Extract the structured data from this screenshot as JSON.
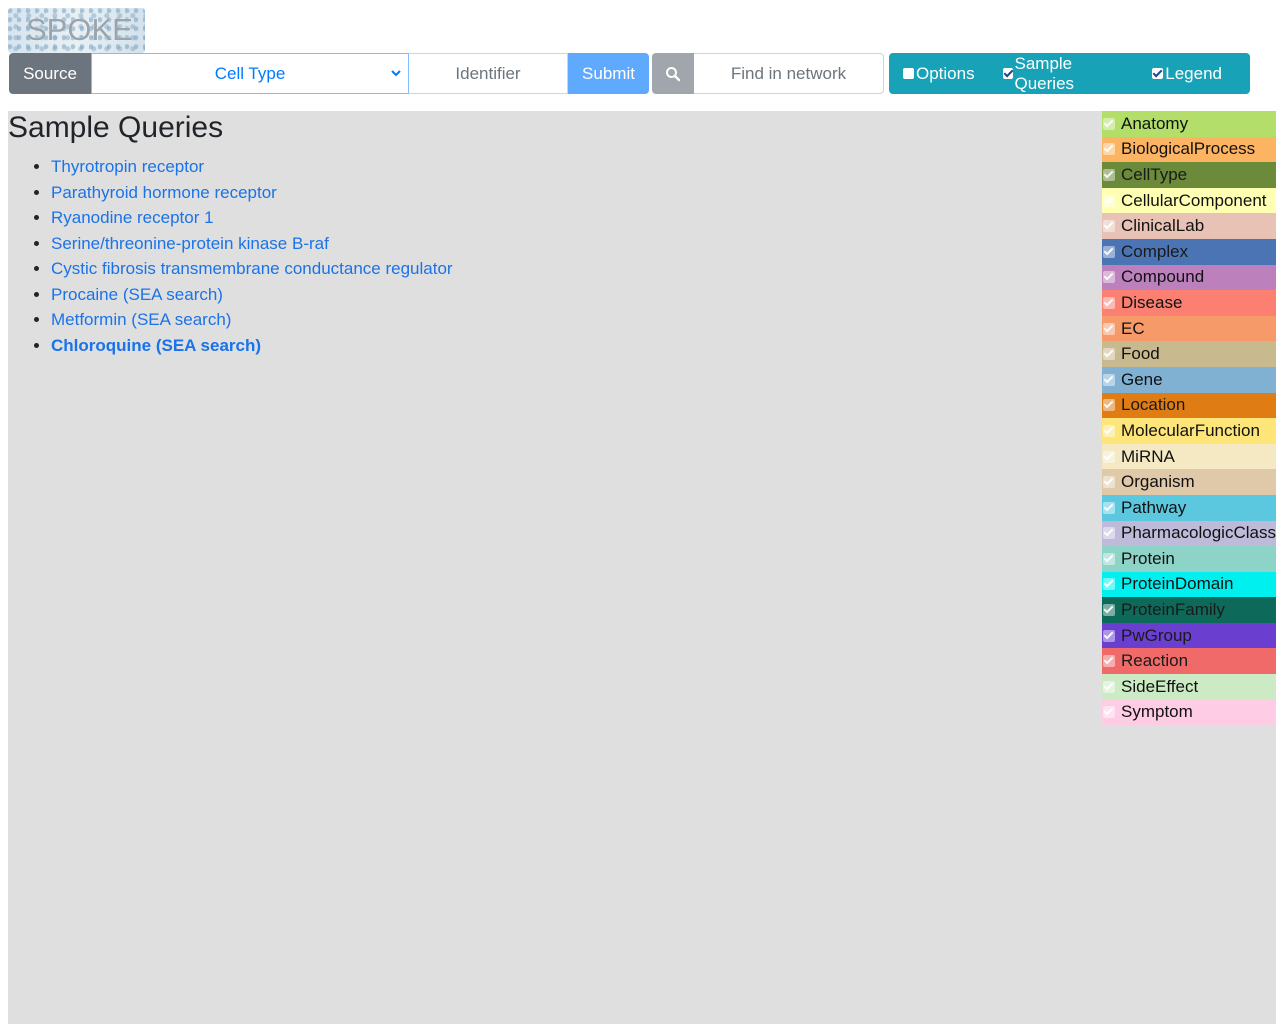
{
  "logo": {
    "text": "SPOKE"
  },
  "toolbar": {
    "source_label": "Source",
    "node_type_selected": "Cell Type",
    "identifier_placeholder": "Identifier",
    "submit_label": "Submit",
    "find_placeholder": "Find in network",
    "toggles": [
      {
        "label": "Options",
        "checked": false
      },
      {
        "label": "Sample Queries",
        "checked": true
      },
      {
        "label": "Legend",
        "checked": true
      }
    ]
  },
  "sample_queries": {
    "title": "Sample Queries",
    "items": [
      {
        "label": "Thyrotropin receptor"
      },
      {
        "label": "Parathyroid hormone receptor"
      },
      {
        "label": "Ryanodine receptor 1"
      },
      {
        "label": "Serine/threonine-protein kinase B-raf"
      },
      {
        "label": "Cystic fibrosis transmembrane conductance regulator"
      },
      {
        "label": "Procaine (SEA search)"
      },
      {
        "label": "Metformin (SEA search)"
      },
      {
        "label": "Chloroquine (SEA search)"
      }
    ]
  },
  "legend": {
    "items": [
      {
        "label": "Anatomy",
        "color": "#b3de69"
      },
      {
        "label": "BiologicalProcess",
        "color": "#fdb462"
      },
      {
        "label": "CellType",
        "color": "#6b8a3a"
      },
      {
        "label": "CellularComponent",
        "color": "#ffffb3"
      },
      {
        "label": "ClinicalLab",
        "color": "#e8c3b5"
      },
      {
        "label": "Complex",
        "color": "#4a74b4"
      },
      {
        "label": "Compound",
        "color": "#bc80bd"
      },
      {
        "label": "Disease",
        "color": "#fb8072"
      },
      {
        "label": "EC",
        "color": "#f79a6a"
      },
      {
        "label": "Food",
        "color": "#c8b98e"
      },
      {
        "label": "Gene",
        "color": "#80b1d3"
      },
      {
        "label": "Location",
        "color": "#e07c14"
      },
      {
        "label": "MolecularFunction",
        "color": "#fee57a"
      },
      {
        "label": "MiRNA",
        "color": "#f5e9c4"
      },
      {
        "label": "Organism",
        "color": "#dfc9a9"
      },
      {
        "label": "Pathway",
        "color": "#5cc8e0"
      },
      {
        "label": "PharmacologicClass",
        "color": "#bebada"
      },
      {
        "label": "Protein",
        "color": "#8dd3c7"
      },
      {
        "label": "ProteinDomain",
        "color": "#00f0f0"
      },
      {
        "label": "ProteinFamily",
        "color": "#0d6a5a"
      },
      {
        "label": "PwGroup",
        "color": "#6a3fd0"
      },
      {
        "label": "Reaction",
        "color": "#f06a6a"
      },
      {
        "label": "SideEffect",
        "color": "#ccebc5"
      },
      {
        "label": "Symptom",
        "color": "#ffcce6"
      }
    ]
  }
}
